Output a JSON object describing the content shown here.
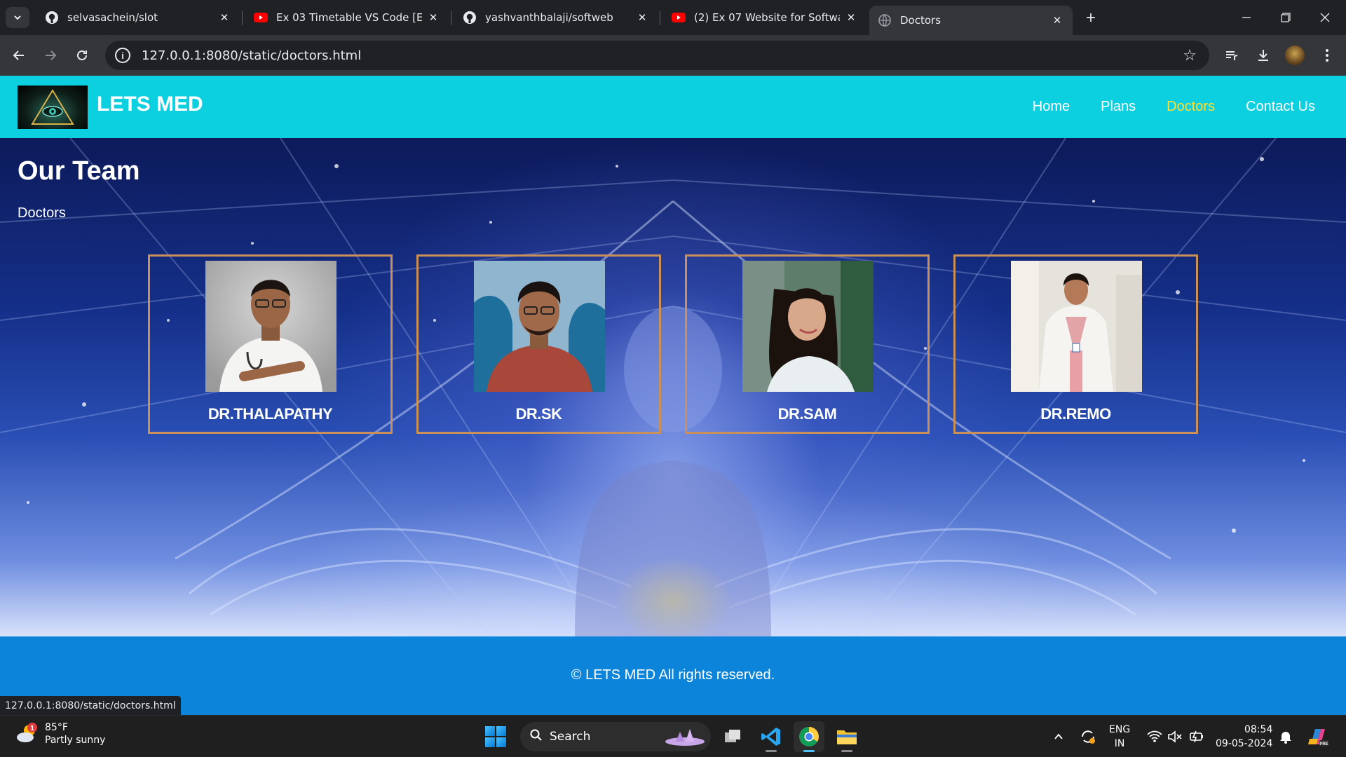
{
  "browser": {
    "tabs": [
      {
        "title": "selvasachein/slot",
        "icon": "github-icon"
      },
      {
        "title": "Ex 03 Timetable VS Code [English]",
        "icon": "youtube-icon"
      },
      {
        "title": "yashvanthbalaji/softweb",
        "icon": "github-icon"
      },
      {
        "title": "(2) Ex 07 Website for Software Company",
        "icon": "youtube-icon"
      },
      {
        "title": "Doctors",
        "icon": "globe-icon",
        "active": true
      }
    ],
    "url": "127.0.0.1:8080/static/doctors.html",
    "status_url": "127.0.0.1:8080/static/doctors.html"
  },
  "site": {
    "brand": "LETS MED",
    "nav": [
      {
        "label": "Home"
      },
      {
        "label": "Plans"
      },
      {
        "label": "Doctors",
        "current": true
      },
      {
        "label": "Contact Us"
      }
    ],
    "title": "Our Team",
    "subtitle": "Doctors",
    "doctors": [
      {
        "name": "DR.THALAPATHY"
      },
      {
        "name": "DR.SK"
      },
      {
        "name": "DR.SAM"
      },
      {
        "name": "DR.REMO"
      }
    ],
    "footer": "© LETS MED All rights reserved.",
    "colors": {
      "header": "#0ccfe0",
      "nav_active": "#ffe033",
      "card_border": "#c9905a",
      "footer": "#0c84d9"
    }
  },
  "taskbar": {
    "weather": {
      "temp": "85°F",
      "desc": "Partly sunny",
      "badge": "1"
    },
    "search_placeholder": "Search",
    "lang": {
      "line1": "ENG",
      "line2": "IN"
    },
    "clock": {
      "time": "08:54",
      "date": "09-05-2024"
    }
  }
}
